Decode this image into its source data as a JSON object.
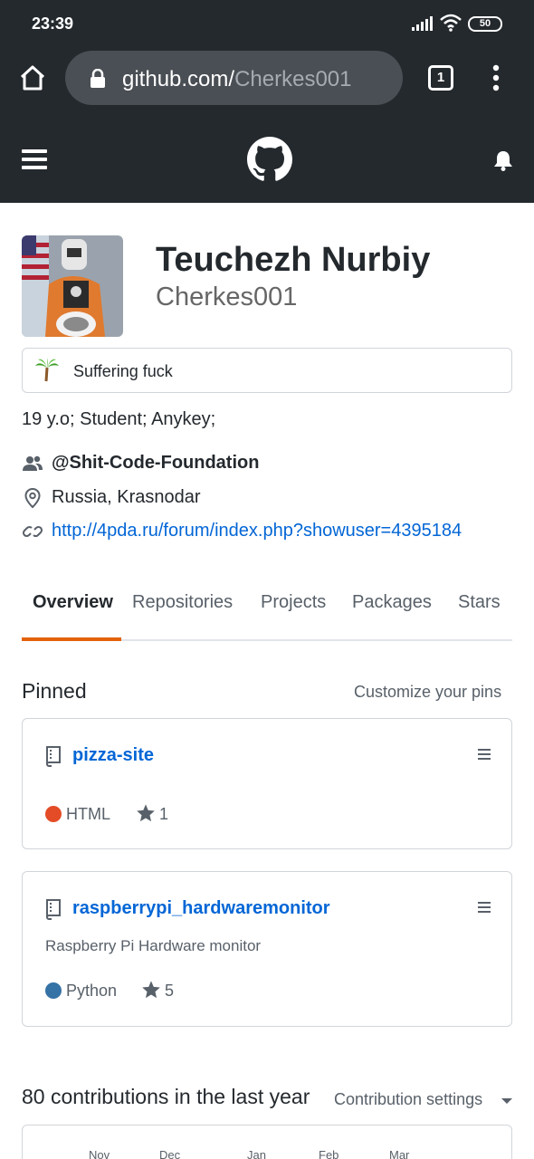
{
  "status_bar": {
    "time": "23:39",
    "battery": "50"
  },
  "browser": {
    "url_host": "github.com/",
    "url_path": "Cherkes001",
    "tab_count": "1"
  },
  "profile": {
    "full_name": "Teuchezh Nurbiy",
    "username": "Cherkes001",
    "status_emoji": "🌴",
    "status_text": "Suffering fuck",
    "bio": "19 y.o; Student; Anykey;",
    "organization": "@Shit-Code-Foundation",
    "location": "Russia, Krasnodar",
    "website": "http://4pda.ru/forum/index.php?showuser=4395184"
  },
  "nav": {
    "tabs": [
      {
        "label": "Overview",
        "active": true
      },
      {
        "label": "Repositories"
      },
      {
        "label": "Projects"
      },
      {
        "label": "Packages"
      },
      {
        "label": "Stars"
      }
    ]
  },
  "pinned": {
    "title": "Pinned",
    "customize_label": "Customize your pins",
    "repos": [
      {
        "name": "pizza-site",
        "description": "",
        "language": "HTML",
        "language_color": "#e34c26",
        "stars": "1"
      },
      {
        "name": "raspberrypi_hardwaremonitor",
        "description": "Raspberry Pi Hardware monitor",
        "language": "Python",
        "language_color": "#3572A5",
        "stars": "5"
      }
    ]
  },
  "contributions": {
    "title": "80 contributions in the last year",
    "settings_label": "Contribution settings",
    "months": [
      "Nov",
      "Dec",
      "Jan",
      "Feb",
      "Mar"
    ]
  },
  "colors": {
    "header_bg": "#24292e",
    "link": "#0366d6",
    "active_tab_underline": "#e36209"
  }
}
